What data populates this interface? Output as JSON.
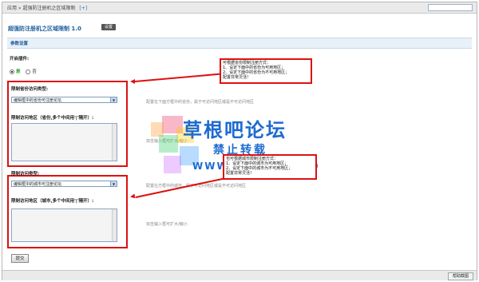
{
  "breadcrumb": {
    "path": "应用 » 超强防注册机之区域限制",
    "add": "[+]"
  },
  "header": {
    "title": "超强防注册机之区域限制 1.0",
    "settings_button": "设置"
  },
  "section": {
    "title": "参数设置"
  },
  "plugin_toggle": {
    "label": "开启插件:",
    "option_yes": "是",
    "option_no": "否",
    "selected": "是"
  },
  "province": {
    "type_label": "限制省份访问类型:",
    "select_value": "编辑框中的省份可注册论坛",
    "description": "配置在下面方框中的省份，属于可访问地区或是不可访问地区",
    "area_label": "限制访问地区（省份,多个中间用'|'隔开）:",
    "area_value": "",
    "hint": "双击输入框可扩大/缩小"
  },
  "city": {
    "type_label": "限制访问类型:",
    "select_value": "编辑框中的城市可注册论坛",
    "description": "配置在方框中的城市，属于可访问地区或是不可访问地区",
    "area_label": "限制访问地区（城市,多个中间用'|'隔开）:",
    "area_value": "",
    "hint": "双击输入框可扩大/缩小"
  },
  "callout_province": {
    "lines": [
      "可根据省份限制注册方式：",
      "1、设定下面中的省份为可用地区；",
      "2、设定下面中的省份为不可用地区；",
      "配置非常灵活！"
    ]
  },
  "callout_city": {
    "lines": [
      "也可根据城市限制注册方式：",
      "1、设定下面中的城市为可用地区；",
      "2、设定下面中的城市为不可用地区；",
      "配置非常灵活！"
    ]
  },
  "watermark": {
    "title": "草根吧论坛",
    "subtitle": "禁止转载",
    "url": "WWW.CAOGEN8.CO"
  },
  "submit_label": "提交",
  "footer": {
    "button": "帮助截图"
  },
  "colors": {
    "accent": "#1f5e9c",
    "annotation_red": "#dd1111",
    "watermark_blue": "#1d6bd1"
  }
}
